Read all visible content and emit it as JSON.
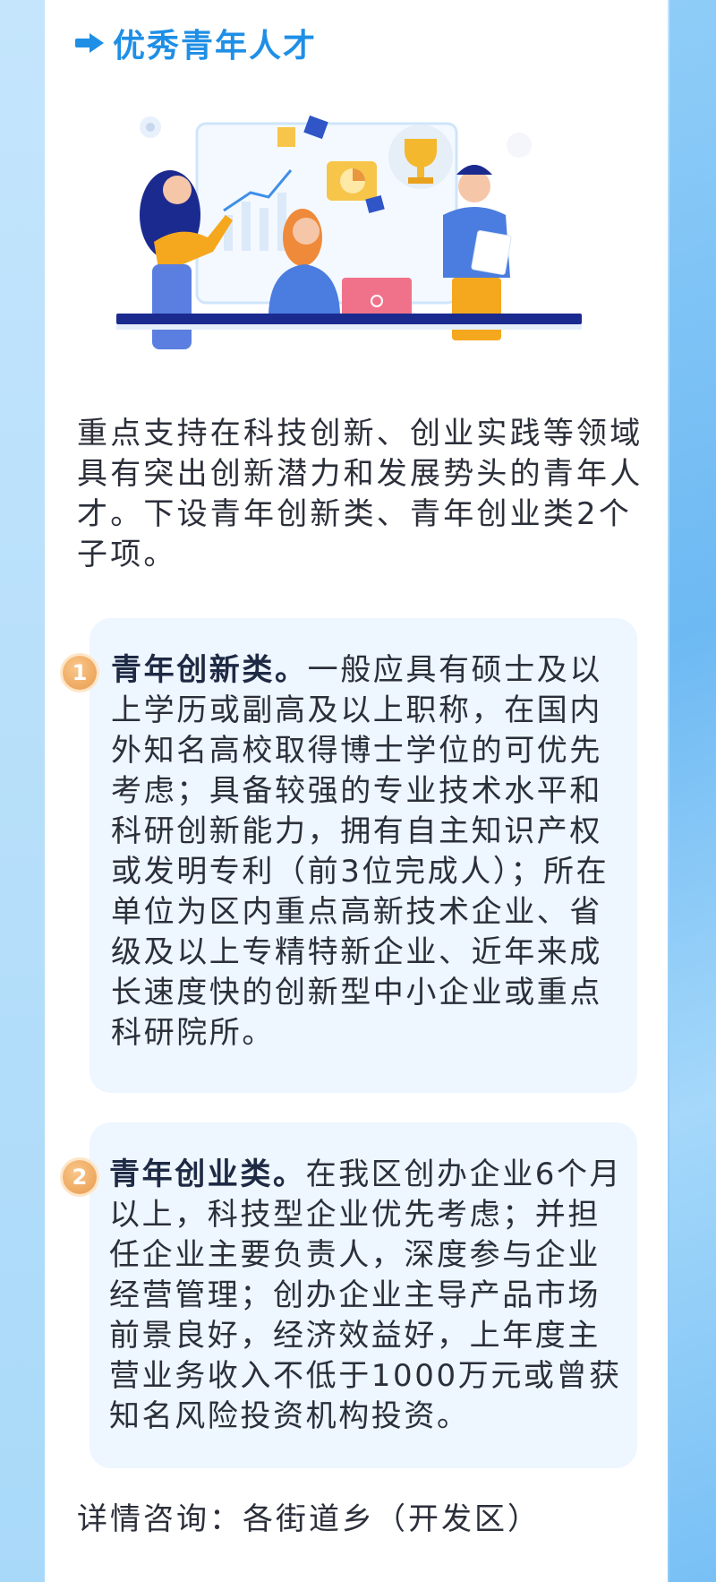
{
  "header": {
    "title": "优秀青年人才",
    "icon": "arrow-right-icon"
  },
  "colors": {
    "accent": "#1f8fe6",
    "card_bg": "#eef6ff",
    "badge": "#e99a4d"
  },
  "intro": "重点支持在科技创新、创业实践等领域具有突出创新潜力和发展势头的青年人才。下设青年创新类、青年创业类2个子项。",
  "items": [
    {
      "badge": "1",
      "lead": "青年创新类。",
      "body": "一般应具有硕士及以上学历或副高及以上职称，在国内外知名高校取得博士学位的可优先考虑；具备较强的专业技术水平和科研创新能力，拥有自主知识产权或发明专利（前3位完成人）；所在单位为区内重点高新技术企业、省级及以上专精特新企业、近年来成长速度快的创新型中小企业或重点科研院所。"
    },
    {
      "badge": "2",
      "lead": "青年创业类。",
      "body": "在我区创办企业6个月以上，科技型企业优先考虑；并担任企业主要负责人，深度参与企业经营管理；创办企业主导产品市场前景良好，经济效益好，上年度主营业务收入不低于1000万元或曾获知名风险投资机构投资。"
    }
  ],
  "contact": "详情咨询：各街道乡（开发区）"
}
